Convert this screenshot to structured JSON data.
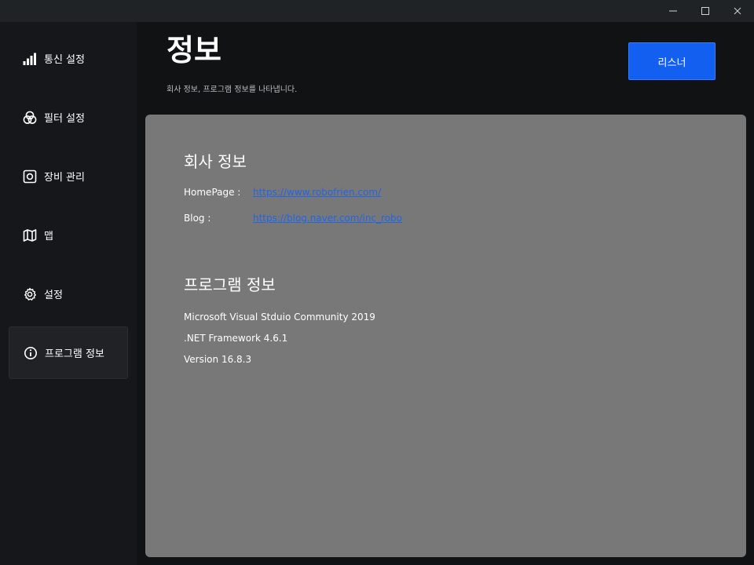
{
  "window": {
    "controls": [
      {
        "name": "minimize",
        "icon": "minimize-icon"
      },
      {
        "name": "maximize",
        "icon": "maximize-icon"
      },
      {
        "name": "close",
        "icon": "close-icon"
      }
    ]
  },
  "sidebar": {
    "items": [
      {
        "label": "통신 설정",
        "icon": "signal-bars-icon",
        "active": false
      },
      {
        "label": "필터 설정",
        "icon": "filter-circles-icon",
        "active": false
      },
      {
        "label": "장비 관리",
        "icon": "device-square-icon",
        "active": false
      },
      {
        "label": "맵",
        "icon": "map-icon",
        "active": false
      },
      {
        "label": "설정",
        "icon": "gear-icon",
        "active": false
      },
      {
        "label": "프로그램 정보",
        "icon": "info-icon",
        "active": true
      }
    ]
  },
  "header": {
    "title": "정보",
    "subtitle": "회사 정보, 프로그램 정보를 나타냅니다.",
    "listener_button": "리스너"
  },
  "company": {
    "title": "회사 정보",
    "homepage_label": "HomePage :",
    "homepage_url": "https://www.robofrien.com/",
    "blog_label": "Blog :",
    "blog_url": "https://blog.naver.com/inc_robo"
  },
  "program": {
    "title": "프로그램 정보",
    "ide": "Microsoft Visual Stduio Community 2019",
    "framework": ".NET Framework 4.6.1",
    "version": "Version 16.8.3"
  },
  "colors": {
    "accent": "#1360f0",
    "link": "#1f66e8",
    "panel": "#787878",
    "background": "#111214",
    "sidebar": "#16171a"
  }
}
